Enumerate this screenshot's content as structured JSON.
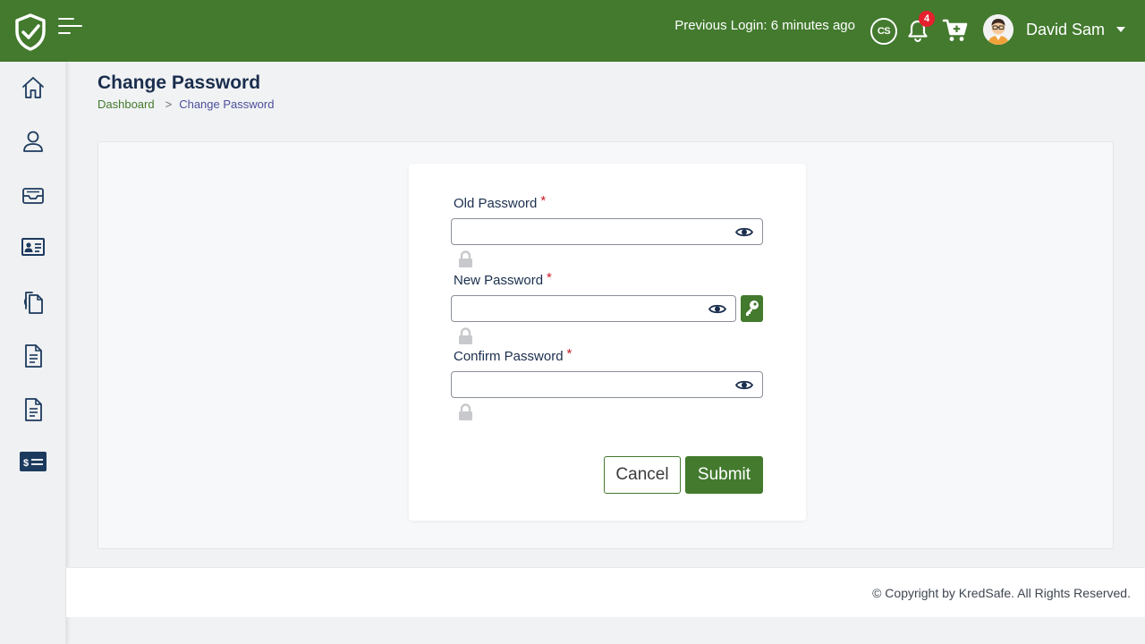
{
  "header": {
    "previous_login": "Previous Login: 6 minutes ago",
    "cs_label": "CS",
    "notification_count": "4",
    "user_name": "David Sam"
  },
  "sidebar": {
    "icons": [
      "home-icon",
      "user-icon",
      "inbox-icon",
      "id-card-icon",
      "documents-icon",
      "file-text-icon",
      "file-list-icon",
      "billing-icon"
    ]
  },
  "page": {
    "title": "Change Password",
    "breadcrumb": {
      "home": "Dashboard",
      "separator": ">",
      "current": "Change Password"
    }
  },
  "form": {
    "old_password_label": "Old Password",
    "new_password_label": "New Password",
    "confirm_password_label": "Confirm Password",
    "required_marker": "*",
    "cancel_label": "Cancel",
    "submit_label": "Submit"
  },
  "footer": {
    "copyright": "© Copyright by KredSafe. All Rights Reserved."
  },
  "colors": {
    "brand_green": "#437a2e",
    "title_navy": "#1a2e4d",
    "badge_red": "#e5202f",
    "sidebar_icon": "#1c3a5e"
  }
}
